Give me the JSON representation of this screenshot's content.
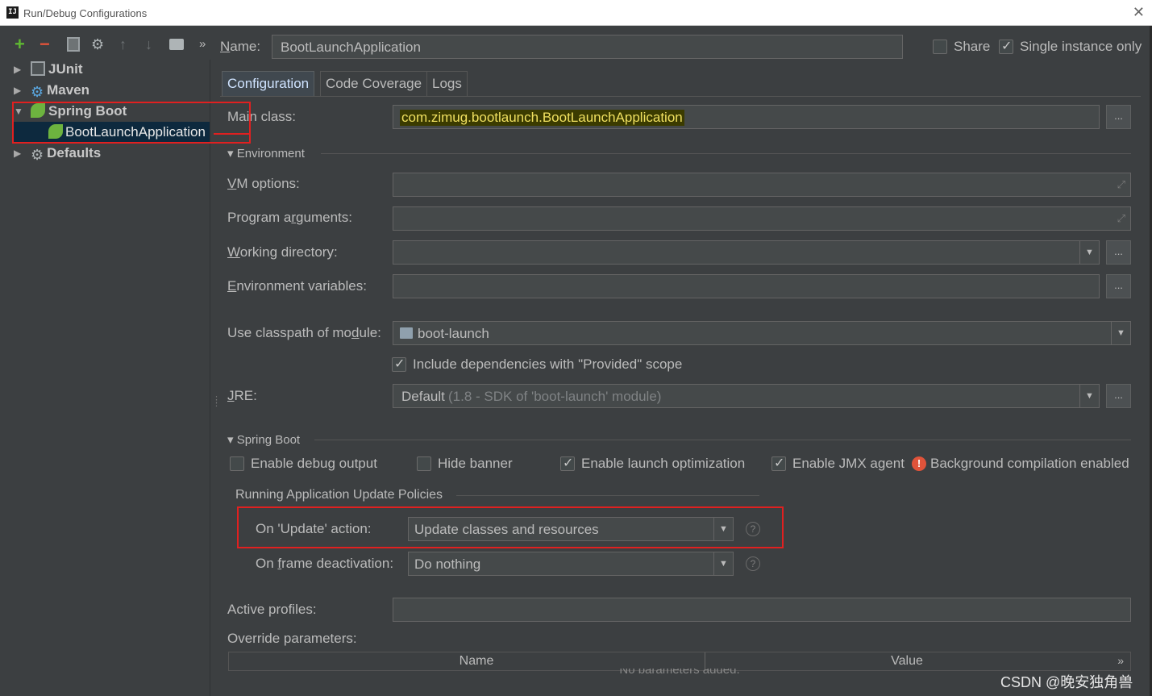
{
  "window": {
    "title": "Run/Debug Configurations",
    "app_icon": "IJ"
  },
  "toolbar": {
    "icons": [
      "add-icon",
      "remove-icon",
      "copy-icon",
      "settings-icon",
      "move-up-icon",
      "move-down-icon",
      "folder-icon",
      "more-icon"
    ],
    "more": "»"
  },
  "tree": {
    "items": [
      {
        "label": "JUnit"
      },
      {
        "label": "Maven"
      },
      {
        "label": "Spring Boot"
      },
      {
        "label": "BootLaunchApplication"
      },
      {
        "label": "Defaults"
      }
    ]
  },
  "header": {
    "name_label": "Name:",
    "name_value": "BootLaunchApplication",
    "share_label": "Share",
    "single_instance_label": "Single instance only"
  },
  "tabs": [
    {
      "label": "Configuration"
    },
    {
      "label": "Code Coverage"
    },
    {
      "label": "Logs"
    }
  ],
  "form": {
    "main_class_label": "Main class:",
    "main_class_value": "com.zimug.bootlaunch.BootLaunchApplication",
    "environment_section": "Environment",
    "vm_options_label": "VM options:",
    "program_arguments_label": "Program arguments:",
    "working_directory_label": "Working directory:",
    "env_vars_label": "Environment variables:",
    "classpath_label": "Use classpath of module:",
    "classpath_value": "boot-launch",
    "include_deps_label": "Include dependencies with \"Provided\" scope",
    "jre_label": "JRE:",
    "jre_value": "Default",
    "jre_hint": "(1.8 - SDK of 'boot-launch' module)",
    "dots": "..."
  },
  "spring_boot": {
    "section": "Spring Boot",
    "debug_output": "Enable debug output",
    "hide_banner": "Hide banner",
    "launch_opt": "Enable launch optimization",
    "jmx_agent": "Enable JMX agent",
    "bg_compile": "Background compilation enabled",
    "policies_title": "Running Application Update Policies",
    "update_action_label": "On 'Update' action:",
    "update_action_value": "Update classes and resources",
    "frame_deact_label": "On frame deactivation:",
    "frame_deact_value": "Do nothing",
    "help": "?"
  },
  "profiles": {
    "active_label": "Active profiles:",
    "override_label": "Override parameters:",
    "col_name": "Name",
    "col_value": "Value",
    "empty_text": "No parameters added.",
    "scroll_more": "»"
  },
  "watermark": "CSDN @晚安独角兽",
  "colors": {
    "accent": "#4b6eaf",
    "highlight": "#3b3b00",
    "red_box": "#e02020",
    "warning": "#e0533a"
  }
}
